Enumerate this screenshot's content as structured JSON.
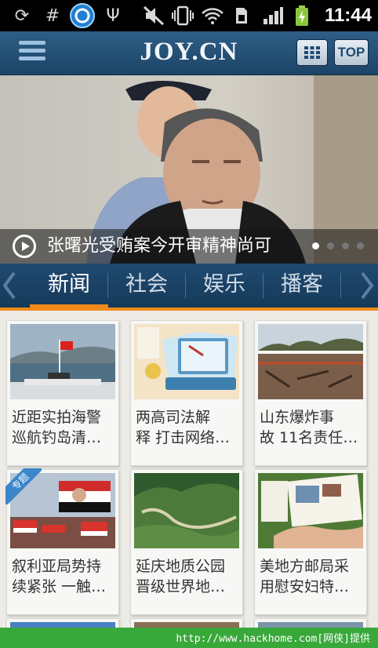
{
  "status_bar": {
    "time": "11:44",
    "icons": [
      "sync-icon",
      "hash-icon",
      "app-icon",
      "usb-icon",
      "mute-icon",
      "vibrate-icon",
      "wifi-icon",
      "sim-icon",
      "signal-icon",
      "battery-icon"
    ],
    "glyphs": {
      "sync": "⟳",
      "hash": "#",
      "usb": "Ψ"
    }
  },
  "header": {
    "logo": "JOY.CN",
    "top_label": "TOP"
  },
  "hero": {
    "title": "张曙光受贿案今开审精神尚可",
    "slide_count": 4,
    "active_slide": 1
  },
  "tabs": [
    {
      "label": "新闻",
      "active": true
    },
    {
      "label": "社会",
      "active": false
    },
    {
      "label": "娱乐",
      "active": false
    },
    {
      "label": "播客",
      "active": false
    }
  ],
  "news": [
    {
      "line1": "近距实拍海警",
      "line2": "巡航钓岛清…"
    },
    {
      "line1": "两高司法解",
      "line2": "释 打击网络…"
    },
    {
      "line1": "山东爆炸事",
      "line2": "故 11名责任…"
    },
    {
      "line1": "叙利亚局势持",
      "line2": "续紧张 一触…",
      "badge": "专题"
    },
    {
      "line1": "延庆地质公园",
      "line2": "晋级世界地…"
    },
    {
      "line1": "美地方邮局采",
      "line2": "用慰安妇特…"
    }
  ],
  "footer": {
    "text": "http://www.hackhome.com[网侠]提供"
  },
  "colors": {
    "header_bg": "#234f76",
    "accent": "#f08a1a",
    "footer_bg": "#39a83b"
  }
}
